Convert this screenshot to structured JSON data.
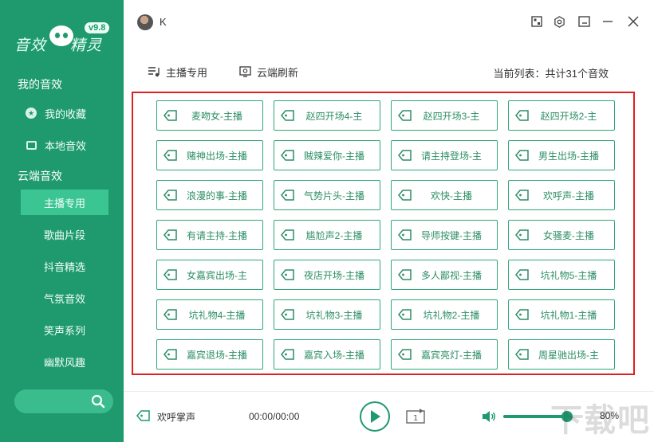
{
  "app": {
    "logo_text_1": "音效",
    "logo_text_2": "精灵",
    "version": "v9.8"
  },
  "user": {
    "name": "K"
  },
  "sidebar": {
    "my_sounds_title": "我的音效",
    "my_items": [
      {
        "label": "我的收藏",
        "icon": "star-icon"
      },
      {
        "label": "本地音效",
        "icon": "disk-icon"
      }
    ],
    "cloud_title": "云端音效",
    "cloud_items": [
      {
        "label": "主播专用",
        "active": true
      },
      {
        "label": "歌曲片段"
      },
      {
        "label": "抖音精选"
      },
      {
        "label": "气氛音效"
      },
      {
        "label": "笑声系列"
      },
      {
        "label": "幽默风趣"
      }
    ],
    "search_placeholder": ""
  },
  "toolbar": {
    "anchor_label": "主播专用",
    "refresh_label": "云端刷新",
    "summary": "当前列表：共计31个音效"
  },
  "sounds": [
    "麦吻女-主播",
    "赵四开场4-主",
    "赵四开场3-主",
    "赵四开场2-主",
    "赌神出场-主播",
    "贼辣爱你-主播",
    "请主持登场-主",
    "男生出场-主播",
    "浪漫的事-主播",
    "气势片头-主播",
    "欢快-主播",
    "欢呼声-主播",
    "有请主持-主播",
    "尴尬声2-主播",
    "导师按键-主播",
    "女骚麦-主播",
    "女嘉宾出场-主",
    "夜店开场-主播",
    "多人鄙视-主播",
    "坑礼物5-主播",
    "坑礼物4-主播",
    "坑礼物3-主播",
    "坑礼物2-主播",
    "坑礼物1-主播",
    "嘉宾退场-主播",
    "嘉宾入场-主播",
    "嘉宾亮灯-主播",
    "周星驰出场-主"
  ],
  "player": {
    "now_playing": "欢呼掌声",
    "time": "00:00/00:00",
    "volume_text": "80%",
    "volume": 0.8
  },
  "watermark": "下载吧",
  "colors": {
    "accent": "#1f9a6e",
    "highlight": "#3bc593",
    "frame": "#e02020"
  }
}
